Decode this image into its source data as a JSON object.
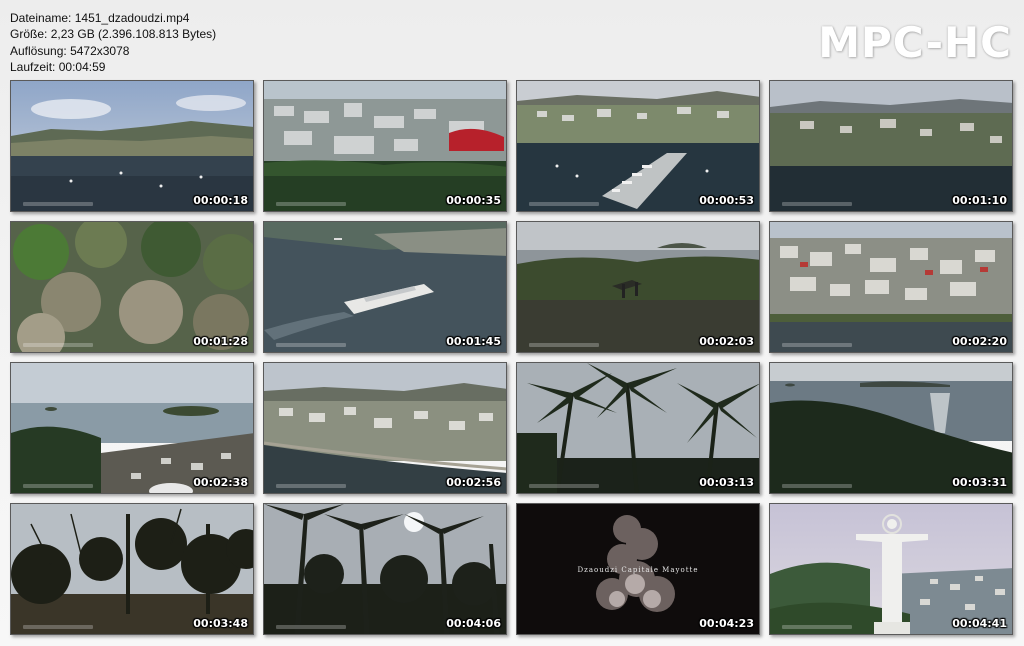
{
  "file_info": {
    "filename_label": "Dateiname:",
    "filename": "1451_dzadoudzi.mp4",
    "size_label": "Größe:",
    "size": "2,23 GB (2.396.108.813 Bytes)",
    "resolution_label": "Auflösung:",
    "resolution": "5472x3078",
    "duration_label": "Laufzeit:",
    "duration": "00:04:59"
  },
  "logo": "MPC-HC",
  "thumbnails": [
    {
      "time": "00:00:18",
      "scene": "bay-town-cloudy-sky-icon"
    },
    {
      "time": "00:00:35",
      "scene": "aerial-town-forest-icon"
    },
    {
      "time": "00:00:53",
      "scene": "marina-harbor-icon"
    },
    {
      "time": "00:01:10",
      "scene": "bay-hillside-town-icon"
    },
    {
      "time": "00:01:28",
      "scene": "dry-forest-aerial-icon"
    },
    {
      "time": "00:01:45",
      "scene": "ferry-on-sea-icon"
    },
    {
      "time": "00:02:03",
      "scene": "hilltop-island-view-icon"
    },
    {
      "time": "00:02:20",
      "scene": "dense-town-waterfront-icon"
    },
    {
      "time": "00:02:38",
      "scene": "coast-islands-view-icon"
    },
    {
      "time": "00:02:56",
      "scene": "coastal-town-road-icon"
    },
    {
      "time": "00:03:13",
      "scene": "palm-trees-icon"
    },
    {
      "time": "00:03:31",
      "scene": "sunlit-sea-hill-icon"
    },
    {
      "time": "00:03:48",
      "scene": "silhouette-trees-dusk-icon"
    },
    {
      "time": "00:04:06",
      "scene": "palm-silhouette-sun-icon"
    },
    {
      "time": "00:04:23",
      "scene": "title-card-smoke-icon",
      "caption": "Dzaoudzi Capitale Mayotte"
    },
    {
      "time": "00:04:41",
      "scene": "christ-statue-town-icon"
    }
  ]
}
